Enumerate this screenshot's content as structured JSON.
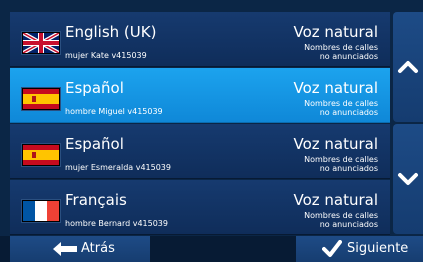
{
  "languages": [
    {
      "name": "English (UK)",
      "voice": "mujer Kate v415039",
      "mode": "Voz natural",
      "note_line1": "Nombres de calles",
      "note_line2": "no anunciados",
      "flag_icon": "uk-flag-icon",
      "selected": false
    },
    {
      "name": "Español",
      "voice": "hombre Miguel v415039",
      "mode": "Voz natural",
      "note_line1": "Nombres de calles",
      "note_line2": "no anunciados",
      "flag_icon": "spain-flag-icon",
      "selected": true
    },
    {
      "name": "Español",
      "voice": "mujer Esmeralda v415039",
      "mode": "Voz natural",
      "note_line1": "Nombres de calles",
      "note_line2": "no anunciados",
      "flag_icon": "spain-flag-icon",
      "selected": false
    },
    {
      "name": "Français",
      "voice": "hombre Bernard v415039",
      "mode": "Voz natural",
      "note_line1": "Nombres de calles",
      "note_line2": "no anunciados",
      "flag_icon": "france-flag-icon",
      "selected": false
    }
  ],
  "scroll": {
    "up_icon": "chevron-up-icon",
    "down_icon": "chevron-down-icon"
  },
  "footer": {
    "back_label": "Atrás",
    "back_icon": "left-arrow-icon",
    "next_label": "Siguiente",
    "next_icon": "checkmark-icon"
  },
  "colors": {
    "selected": "#1ca3ee",
    "row": "#163a6f",
    "background": "#0b2646"
  }
}
